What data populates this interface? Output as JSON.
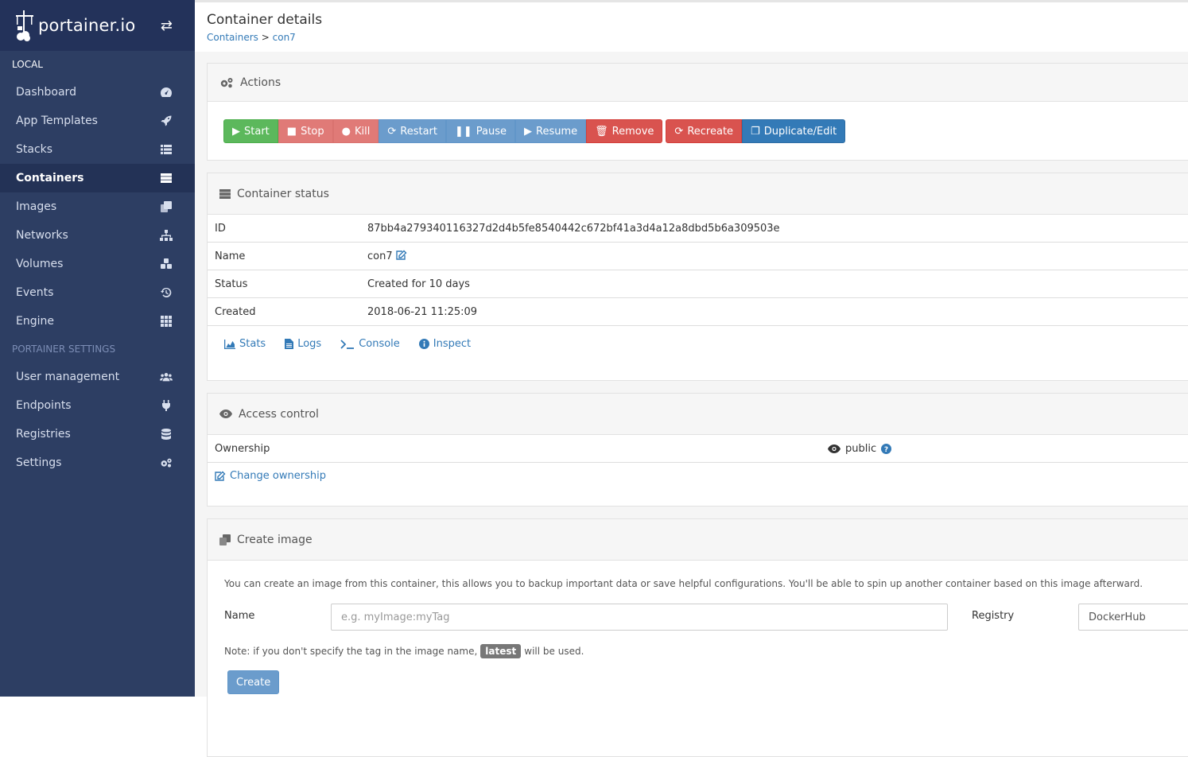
{
  "brand": {
    "name": "portainer.io"
  },
  "sidebar": {
    "section_local": "LOCAL",
    "items": [
      {
        "label": "Dashboard",
        "icon": "tachometer-icon"
      },
      {
        "label": "App Templates",
        "icon": "rocket-icon"
      },
      {
        "label": "Stacks",
        "icon": "th-list-icon"
      },
      {
        "label": "Containers",
        "icon": "server-icon",
        "active": true
      },
      {
        "label": "Images",
        "icon": "clone-icon"
      },
      {
        "label": "Networks",
        "icon": "sitemap-icon"
      },
      {
        "label": "Volumes",
        "icon": "cubes-icon"
      },
      {
        "label": "Events",
        "icon": "history-icon"
      },
      {
        "label": "Engine",
        "icon": "th-icon"
      }
    ],
    "section_settings": "PORTAINER SETTINGS",
    "settings_items": [
      {
        "label": "User management",
        "icon": "users-icon"
      },
      {
        "label": "Endpoints",
        "icon": "plug-icon"
      },
      {
        "label": "Registries",
        "icon": "database-icon"
      },
      {
        "label": "Settings",
        "icon": "cogs-icon"
      }
    ]
  },
  "header": {
    "title": "Container details",
    "breadcrumb_root": "Containers",
    "breadcrumb_sep": ">",
    "breadcrumb_current": "con7"
  },
  "actions": {
    "title": "Actions",
    "buttons": {
      "start": "Start",
      "stop": "Stop",
      "kill": "Kill",
      "restart": "Restart",
      "pause": "Pause",
      "resume": "Resume",
      "remove": "Remove",
      "recreate": "Recreate",
      "duplicate": "Duplicate/Edit"
    }
  },
  "status": {
    "title": "Container status",
    "rows": [
      {
        "key": "ID",
        "value": "87bb4a279340116327d2d4b5fe8540442c672bf41a3d4a12a8dbd5b6a309503e"
      },
      {
        "key": "Name",
        "value": "con7"
      },
      {
        "key": "Status",
        "value": "Created for 10 days"
      },
      {
        "key": "Created",
        "value": "2018-06-21 11:25:09"
      }
    ],
    "links": {
      "stats": "Stats",
      "logs": "Logs",
      "console": "Console",
      "inspect": "Inspect"
    }
  },
  "access": {
    "title": "Access control",
    "ownership_label": "Ownership",
    "ownership_value": "public",
    "change_link": "Change ownership"
  },
  "create_image": {
    "title": "Create image",
    "description": "You can create an image from this container, this allows you to backup important data or save helpful configurations. You'll be able to spin up another container based on this image afterward.",
    "name_label": "Name",
    "name_placeholder": "e.g. myImage:myTag",
    "registry_label": "Registry",
    "registry_value": "DockerHub",
    "note_prefix": "Note: if you don't specify the tag in the image name,",
    "note_tag": "latest",
    "note_suffix": "will be used.",
    "create_button": "Create"
  },
  "colors": {
    "sidebar_bg": "#2d3e63",
    "brand_bg": "#23325a",
    "success": "#5cb85c",
    "danger": "#d9534f",
    "primary": "#337ab7",
    "link": "#337ab7"
  }
}
